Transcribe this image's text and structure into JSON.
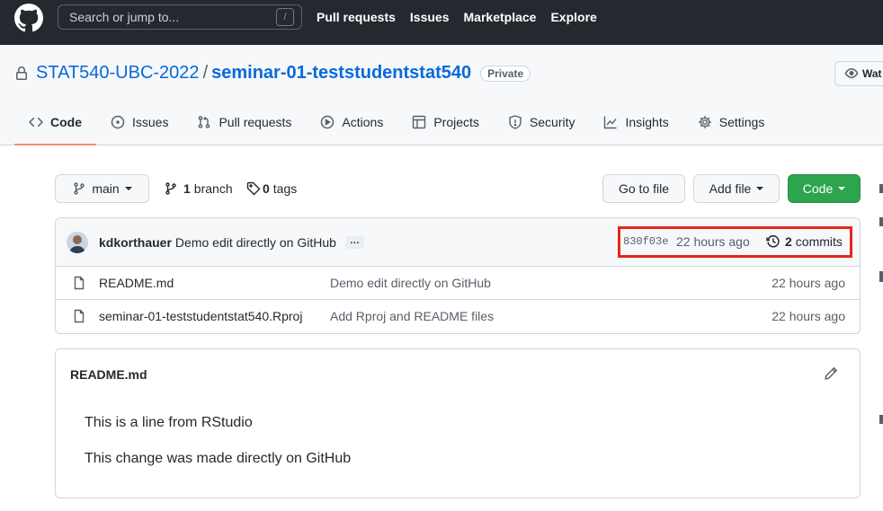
{
  "header": {
    "search_placeholder": "Search or jump to...",
    "search_shortcut": "/",
    "nav": [
      "Pull requests",
      "Issues",
      "Marketplace",
      "Explore"
    ]
  },
  "repo": {
    "owner": "STAT540-UBC-2022",
    "separator": "/",
    "name": "seminar-01-teststudentstat540",
    "visibility": "Private",
    "watch_label": "Wat"
  },
  "tabs": [
    {
      "label": "Code",
      "icon": "code-icon",
      "active": true
    },
    {
      "label": "Issues",
      "icon": "issue-icon"
    },
    {
      "label": "Pull requests",
      "icon": "pull-request-icon"
    },
    {
      "label": "Actions",
      "icon": "play-icon"
    },
    {
      "label": "Projects",
      "icon": "table-icon"
    },
    {
      "label": "Security",
      "icon": "shield-icon"
    },
    {
      "label": "Insights",
      "icon": "graph-icon"
    },
    {
      "label": "Settings",
      "icon": "gear-icon"
    }
  ],
  "toolbar": {
    "branch": "main",
    "branch_count": "1",
    "branch_label": "branch",
    "tag_count": "0",
    "tag_label": "tags",
    "go_to_file": "Go to file",
    "add_file": "Add file",
    "code": "Code"
  },
  "latest_commit": {
    "author": "kdkorthauer",
    "message": "Demo edit directly on GitHub",
    "ellipsis": "…",
    "sha": "830f03e",
    "age": "22 hours ago",
    "commit_count": "2",
    "commit_label": "commits"
  },
  "files": [
    {
      "name": "README.md",
      "commit": "Demo edit directly on GitHub",
      "age": "22 hours ago"
    },
    {
      "name": "seminar-01-teststudentstat540.Rproj",
      "commit": "Add Rproj and README files",
      "age": "22 hours ago"
    }
  ],
  "readme": {
    "title": "README.md",
    "lines": [
      "This is a line from RStudio",
      "This change was made directly on GitHub"
    ]
  },
  "colors": {
    "header_bg": "#24292f",
    "link": "#0969da",
    "green": "#2da44e",
    "highlight": "#e5261b",
    "tab_underline": "#fd8c73"
  }
}
